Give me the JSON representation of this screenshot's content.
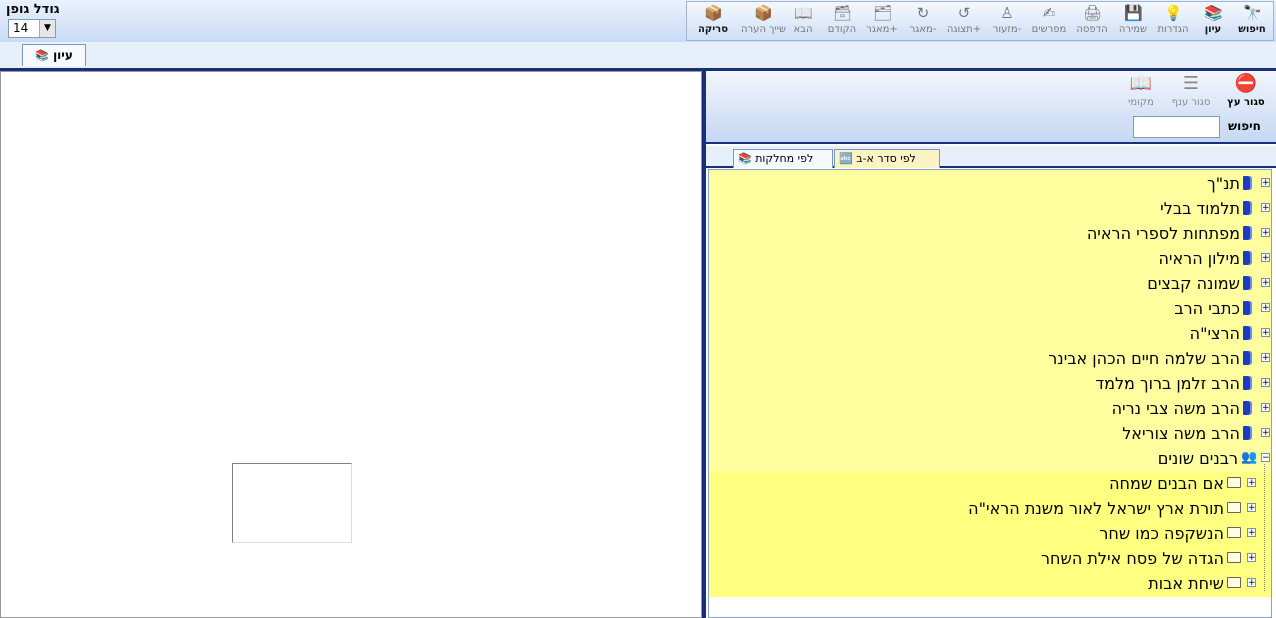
{
  "toolbar": {
    "buttons": [
      {
        "label": "חיפוש",
        "icon": "binoculars-icon",
        "glyph": "🔭",
        "enabled": true
      },
      {
        "label": "עיון",
        "icon": "books-icon",
        "glyph": "📚",
        "enabled": true
      },
      {
        "label": "הגדרות",
        "icon": "lightbulb-icon",
        "glyph": "💡",
        "enabled": false
      },
      {
        "label": "שמירה",
        "icon": "save-icon",
        "glyph": "💾",
        "enabled": false
      },
      {
        "label": "הדפסה",
        "icon": "print-icon",
        "glyph": "🖨",
        "enabled": false
      },
      {
        "label": "מפרשים",
        "icon": "commentators-icon",
        "glyph": "✍",
        "enabled": false
      },
      {
        "label": "מזעור-",
        "icon": "zoom-out-icon",
        "glyph": "♙",
        "enabled": false
      },
      {
        "label": "תצוגה+",
        "icon": "zoom-in-icon",
        "glyph": "↺",
        "enabled": false
      },
      {
        "label": "מאגר-",
        "icon": "refresh-icon",
        "glyph": "↻",
        "enabled": false
      },
      {
        "label": "מאגר+",
        "icon": "archive-plus-icon",
        "glyph": "🗂",
        "enabled": false
      },
      {
        "label": "הקודם",
        "icon": "previous-icon",
        "glyph": "🗃",
        "enabled": false
      },
      {
        "label": "הבא",
        "icon": "next-icon",
        "glyph": "📖",
        "enabled": false
      },
      {
        "label": "שייך הערה",
        "icon": "note-icon",
        "glyph": "📦",
        "enabled": false
      },
      {
        "label": "סריקה",
        "icon": "scan-icon",
        "glyph": "📦",
        "enabled": true
      }
    ]
  },
  "font_size": {
    "label": "גודל גופן",
    "value": "14"
  },
  "main_tab": {
    "label": "עיון"
  },
  "panel": {
    "buttons": [
      {
        "label": "סגור עץ",
        "icon": "close-tree-icon",
        "glyph": "⛔",
        "enabled": true
      },
      {
        "label": "סגור ענף",
        "icon": "close-branch-icon",
        "glyph": "☰",
        "enabled": false
      },
      {
        "label": "מקומי",
        "icon": "local-book-icon",
        "glyph": "📖",
        "enabled": false
      }
    ],
    "search_label": "חיפוש",
    "search_value": ""
  },
  "tree_tabs": [
    {
      "label": "לפי סדר א-ב",
      "active": true
    },
    {
      "label": "לפי מחלקות",
      "active": false
    }
  ],
  "tree": [
    {
      "label": "תנ\"ך",
      "level": 0,
      "type": "book",
      "expanded": false
    },
    {
      "label": "תלמוד בבלי",
      "level": 0,
      "type": "book",
      "expanded": false
    },
    {
      "label": "מפתחות לספרי הראיה",
      "level": 0,
      "type": "book",
      "expanded": false
    },
    {
      "label": "מילון הראיה",
      "level": 0,
      "type": "book",
      "expanded": false
    },
    {
      "label": "שמונה קבצים",
      "level": 0,
      "type": "book",
      "expanded": false
    },
    {
      "label": "כתבי הרב",
      "level": 0,
      "type": "book",
      "expanded": false
    },
    {
      "label": "הרצי\"ה",
      "level": 0,
      "type": "book",
      "expanded": false
    },
    {
      "label": "הרב שלמה חיים הכהן אבינר",
      "level": 0,
      "type": "book",
      "expanded": false
    },
    {
      "label": "הרב זלמן ברוך מלמד",
      "level": 0,
      "type": "book",
      "expanded": false
    },
    {
      "label": "הרב משה צבי נריה",
      "level": 0,
      "type": "book",
      "expanded": false
    },
    {
      "label": "הרב משה צוריאל",
      "level": 0,
      "type": "book",
      "expanded": false
    },
    {
      "label": "רבנים שונים",
      "level": 0,
      "type": "group",
      "expanded": true
    },
    {
      "label": "אם הבנים שמחה",
      "level": 1,
      "type": "folder",
      "expanded": false
    },
    {
      "label": "תורת ארץ ישראל לאור משנת הראי\"ה",
      "level": 1,
      "type": "folder",
      "expanded": false
    },
    {
      "label": "הנשקפה כמו שחר",
      "level": 1,
      "type": "folder",
      "expanded": false
    },
    {
      "label": "הגדה של פסח אילת השחר",
      "level": 1,
      "type": "folder",
      "expanded": false
    },
    {
      "label": "שיחת אבות",
      "level": 1,
      "type": "folder",
      "expanded": false
    }
  ],
  "colors": {
    "tree_bg": "#ffff9f",
    "tree_child_bg": "#ffff80",
    "accent": "#1a2f7a"
  }
}
